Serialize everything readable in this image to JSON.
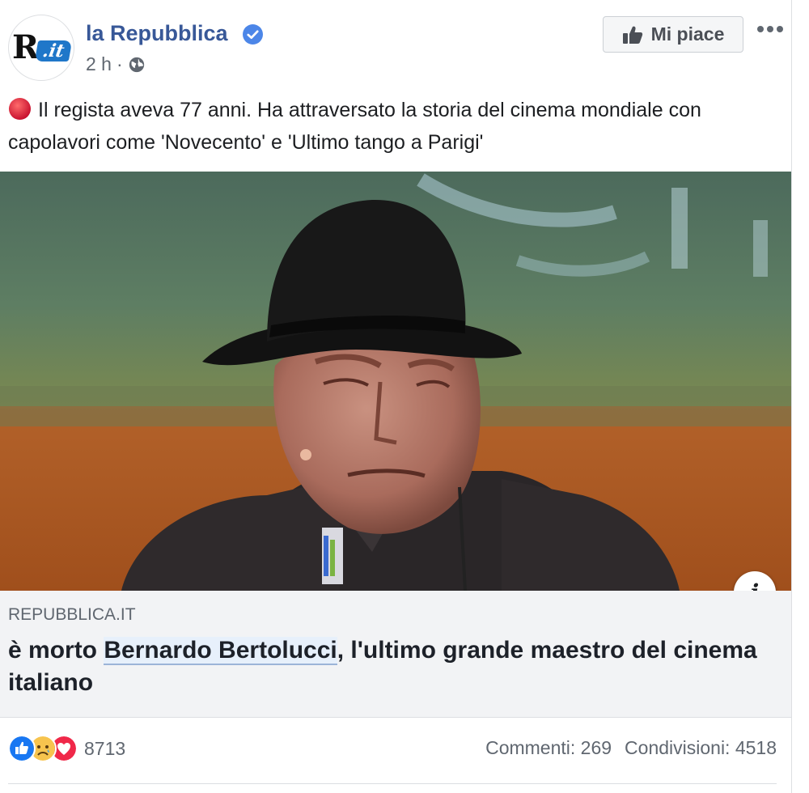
{
  "header": {
    "logo": "R.it",
    "page_name": "la Repubblica",
    "time": "2 h",
    "separator": "·",
    "audience_icon": "globe-icon",
    "verified_icon": "verified-badge-icon",
    "like_page_label": "Mi piace",
    "more_icon": "more-options-icon"
  },
  "post": {
    "text": "Il regista aveva 77 anni. Ha attraversato la storia del cinema mondiale con capolavori come 'Novecento' e 'Ultimo tango a Parigi'",
    "leading_emoji": "red-circle-icon"
  },
  "link_preview": {
    "domain": "REPUBBLICA.IT",
    "title_before": "è morto ",
    "title_highlight": "Bernardo Bertolucci",
    "title_after": ", l'ultimo grande maestro del cinema italiano",
    "info_label": "i"
  },
  "footer": {
    "reaction_icons": [
      "like-reaction-icon",
      "sad-reaction-icon",
      "love-reaction-icon"
    ],
    "reaction_count": "8713",
    "comments": "Commenti: 269",
    "shares": "Condivisioni: 4518"
  },
  "colors": {
    "brand_blue": "#385898",
    "facebook_blue": "#1877f2",
    "link_bg": "#f2f3f5",
    "secondary_text": "#606770"
  }
}
